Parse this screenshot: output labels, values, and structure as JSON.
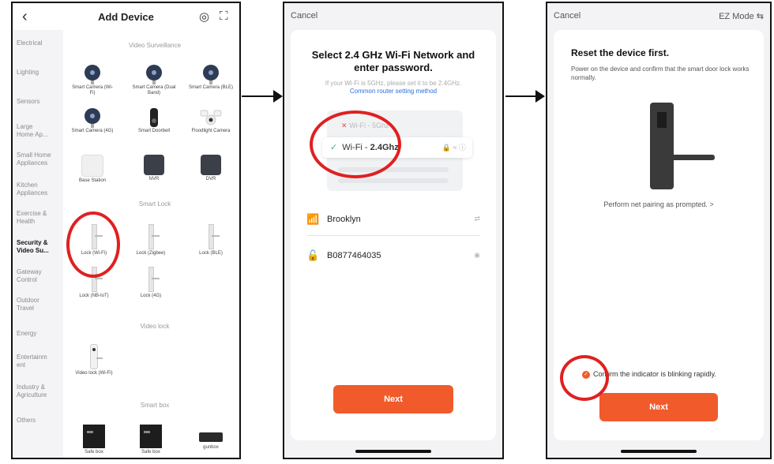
{
  "screen1": {
    "title": "Add Device",
    "categories": [
      "Electrical",
      "Lighting",
      "Sensors",
      "Large Home Ap...",
      "Small Home Appliances",
      "Kitchen Appliances",
      "Exercise & Health",
      "Security & Video Su...",
      "Gateway Control",
      "Outdoor Travel",
      "Energy",
      "Entertainm ent",
      "Industry & Agriculture",
      "Others"
    ],
    "sections": {
      "video_surveillance": "Video Surveillance",
      "smart_lock": "Smart Lock",
      "video_lock": "Video lock",
      "smart_box": "Smart box"
    },
    "devices": {
      "cam_wifi": "Smart Camera (Wi-Fi)",
      "cam_dual": "Smart Camera (Dual Band)",
      "cam_ble": "Smart Camera (BLE)",
      "cam_4g": "Smart Camera (4G)",
      "doorbell": "Smart Doorbell",
      "floodlight": "Floodlight Camera",
      "base_station": "Base Station",
      "nvr": "NVR",
      "dvr": "DVR",
      "lock_wifi": "Lock (Wi-Fi)",
      "lock_zigbee": "Lock (Zigbee)",
      "lock_ble": "Lock (BLE)",
      "lock_nbiot": "Lock (NB-IoT)",
      "lock_4g": "Lock (4G)",
      "video_lock": "Video lock (Wi-Fi)",
      "safe_box_1": "Safe box",
      "safe_box_2": "Safe box",
      "gunbox": "gunbox"
    }
  },
  "screen2": {
    "cancel": "Cancel",
    "heading": "Select 2.4 GHz Wi-Fi Network and enter password.",
    "hint": "If your Wi-Fi is 5GHz, please set it to be 2.4GHz.",
    "link": "Common router setting method",
    "wifi_bad": "Wi-Fi - 5Ghz",
    "wifi_good_prefix": "Wi-Fi - ",
    "wifi_good_band": "2.4Ghz",
    "ssid": "Brooklyn",
    "password": "B0877464035",
    "next": "Next"
  },
  "screen3": {
    "cancel": "Cancel",
    "mode": "EZ Mode ⇆",
    "heading": "Reset the device first.",
    "text": "Power on the device and confirm that the smart door lock works normally.",
    "pairing": "Perform net pairing as prompted. >",
    "confirm": "Confirm the indicator is blinking rapidly.",
    "next": "Next"
  },
  "colors": {
    "accent": "#f15a2b",
    "highlight_circle": "#e02020",
    "link": "#2d6fd9"
  }
}
